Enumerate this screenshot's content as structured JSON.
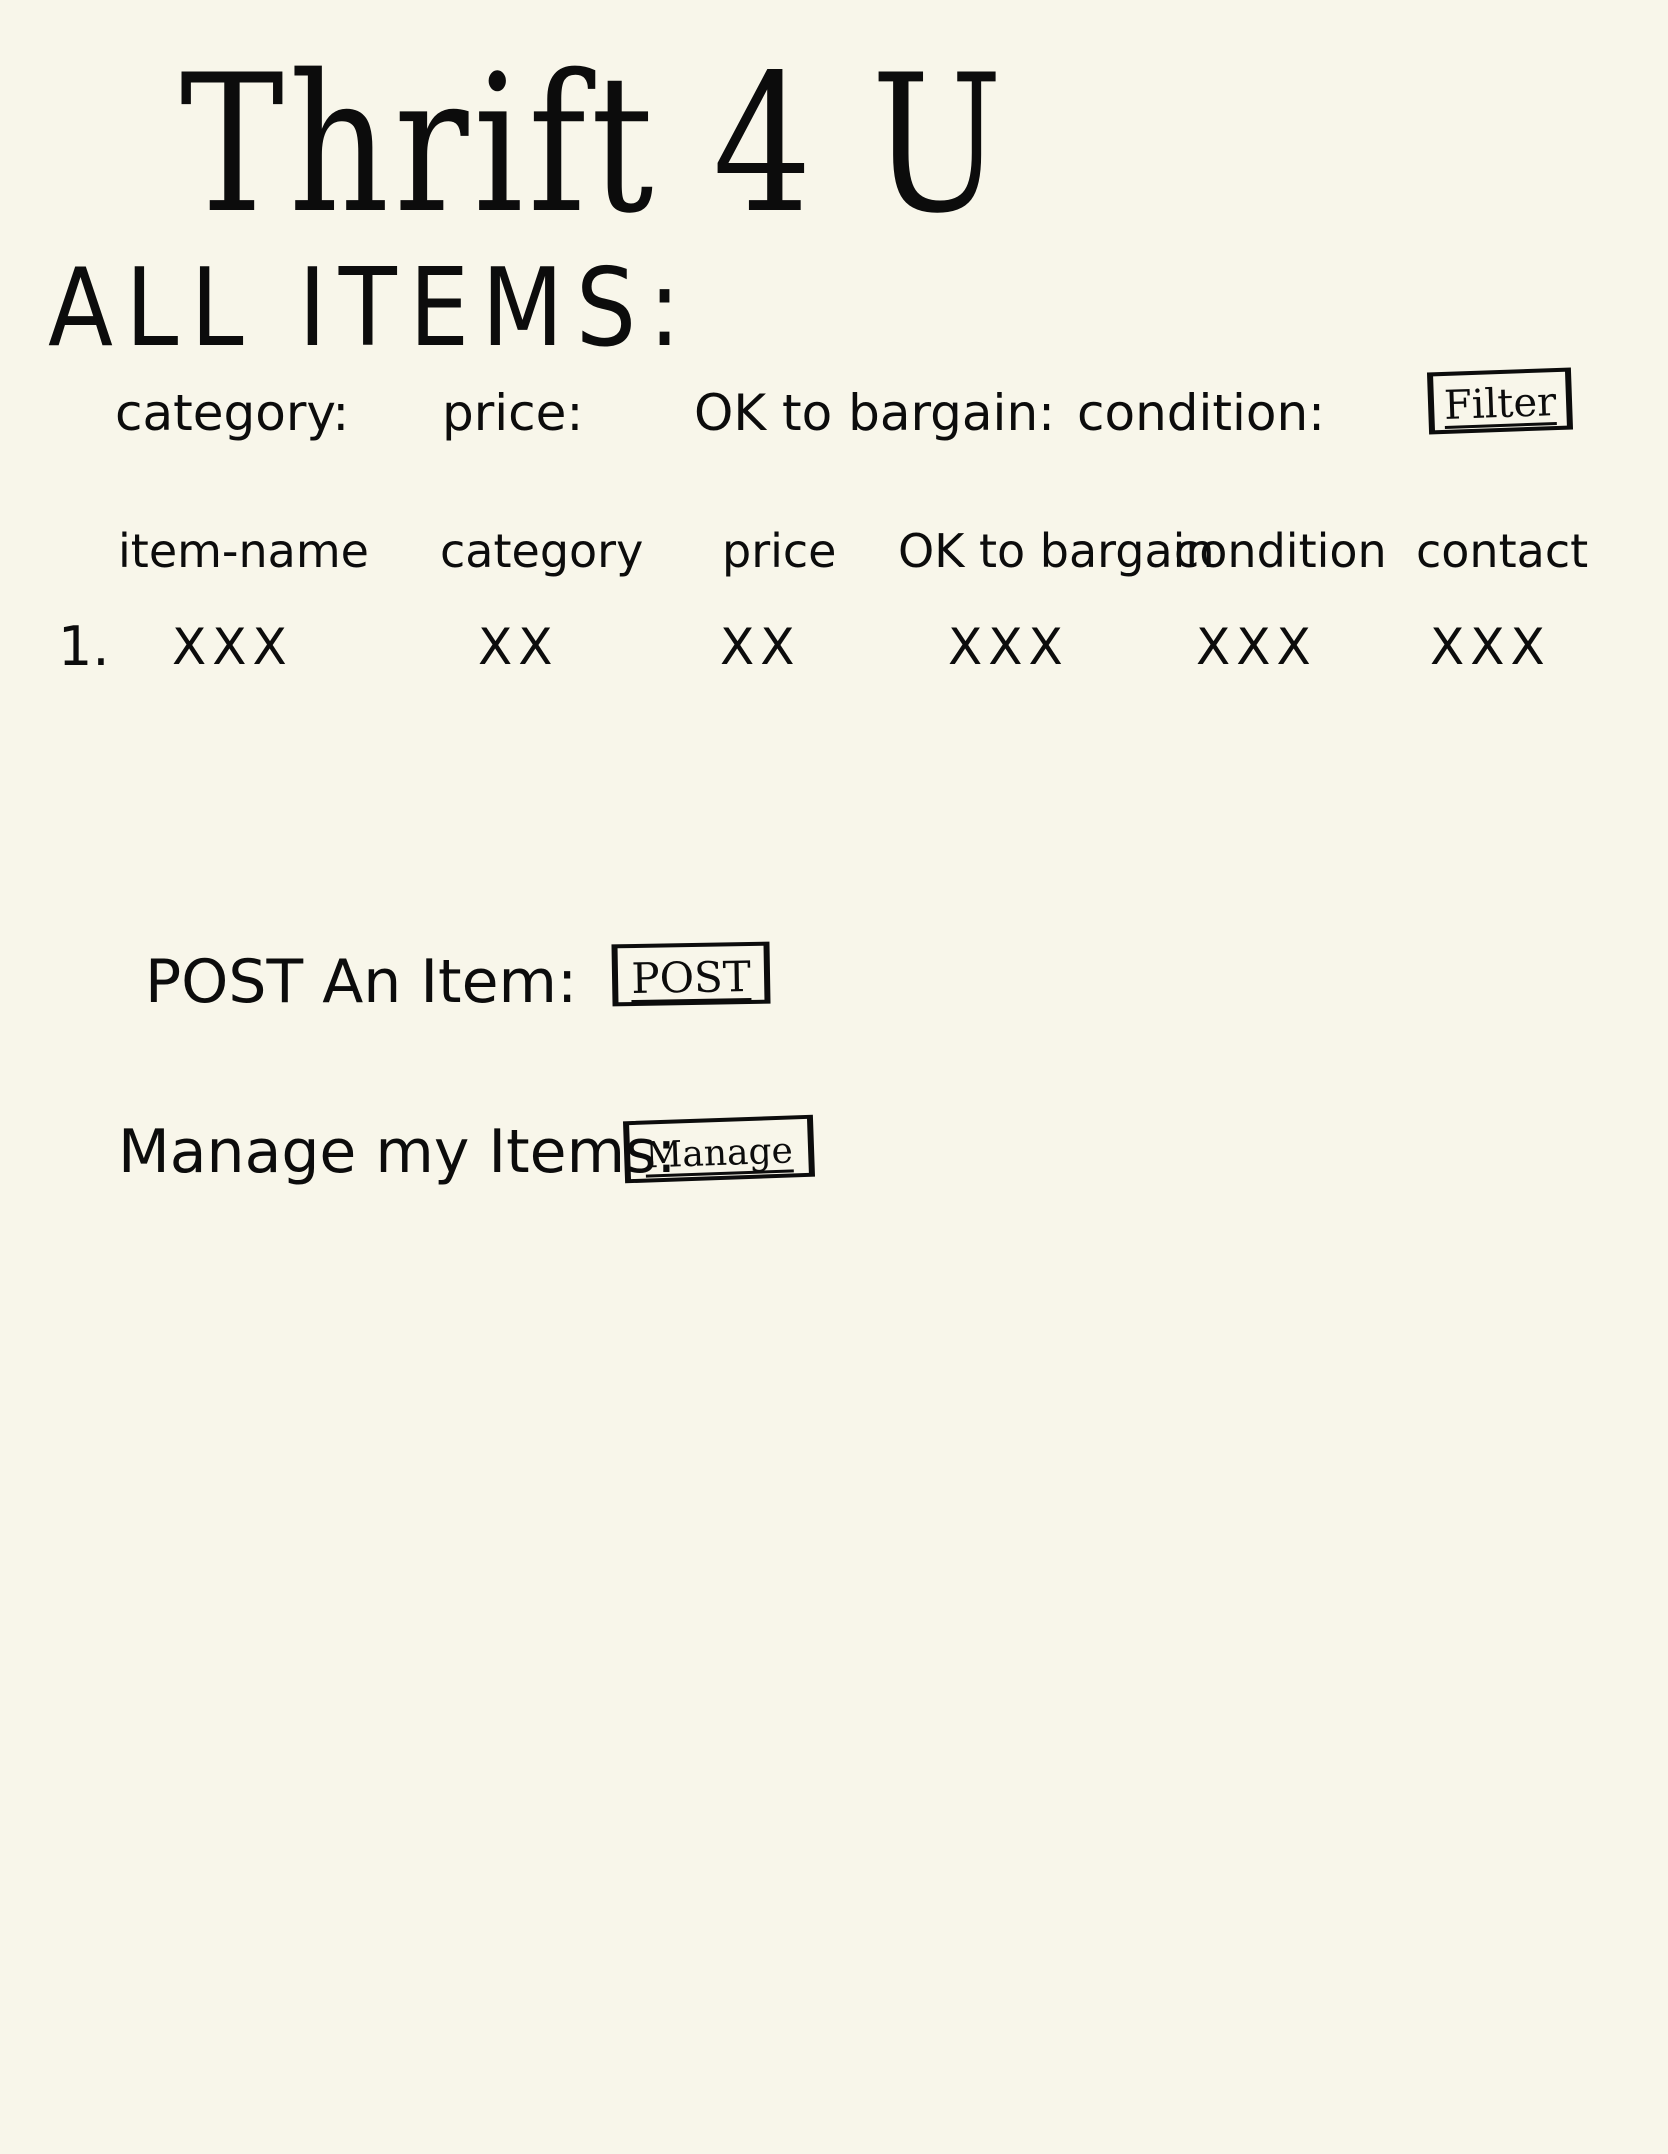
{
  "app": {
    "title": "Thrift 4 U"
  },
  "items_section": {
    "heading": "ALL ITEMS:"
  },
  "filters": {
    "category_label": "category:",
    "price_label": "price:",
    "bargain_label": "OK to bargain:",
    "condition_label": "condition:",
    "filter_button_label": "Filter"
  },
  "table": {
    "columns": [
      "item-name",
      "category",
      "price",
      "OK to bargain",
      "condition",
      "contact"
    ],
    "rows": [
      {
        "number": "1.",
        "cells": [
          "XXX",
          "XX",
          "XX",
          "XXX",
          "XXX",
          "XXX"
        ]
      }
    ]
  },
  "post": {
    "label": "POST An Item:",
    "button_label": "POST"
  },
  "manage": {
    "label": "Manage my Items:",
    "button_label": "Manage"
  }
}
